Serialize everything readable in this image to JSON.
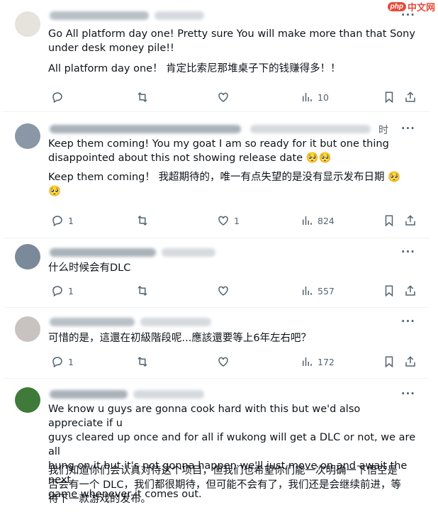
{
  "watermark": {
    "logo": "php",
    "site": "中文网"
  },
  "tweets": [
    {
      "lines": [
        "Go All platform day one! Pretty sure You will make more than that Sony\nunder desk money pile!!",
        "All platform day one！ 肯定比索尼那堆桌子下的钱赚得多！！"
      ],
      "reply_count": "",
      "retweet_count": "",
      "like_count": "",
      "view_count": "10"
    },
    {
      "lines": [
        "Keep them coming! You my goat I am so ready for it but one thing\ndisappointed about this not showing release date 🥺🥺",
        "Keep them coming！ 我超期待的，唯一有点失望的是没有显示发布日期 🥺\n🥺"
      ],
      "header_suffix": "时",
      "reply_count": "1",
      "retweet_count": "",
      "like_count": "1",
      "view_count": "824"
    },
    {
      "lines": [
        "什么时候会有DLC"
      ],
      "reply_count": "1",
      "retweet_count": "",
      "like_count": "",
      "view_count": "557"
    },
    {
      "lines": [
        "可惜的是，這還在初級階段呢...應該還要等上6年左右吧？"
      ],
      "reply_count": "1",
      "retweet_count": "",
      "like_count": "",
      "view_count": "172"
    },
    {
      "lines": [
        "We know u guys are gonna cook hard with this but we'd also appreciate if u\nguys cleared up once and for all if wukong will get a DLC or not, we are all\nhung on it but it's not gonna happen we'll just move on and await the next\ngame whenever it comes out.",
        "我们知道你们会认真对待这个项目，但我们也希望你们能一次明确一下悟空是\n否会有一个 DLC，我们都很期待，但可能不会有了，我们还是会继续前进，等\n待下一款游戏的发布。"
      ]
    }
  ],
  "icons": {
    "reply": "reply-icon",
    "retweet": "retweet-icon",
    "like": "like-icon",
    "views": "views-icon",
    "bookmark": "bookmark-icon",
    "share": "share-icon",
    "more": "more-icon"
  },
  "colors": {
    "text": "#0f1419",
    "muted": "#536471",
    "divider": "#eff3f4",
    "watermark": "#e74c3c"
  }
}
